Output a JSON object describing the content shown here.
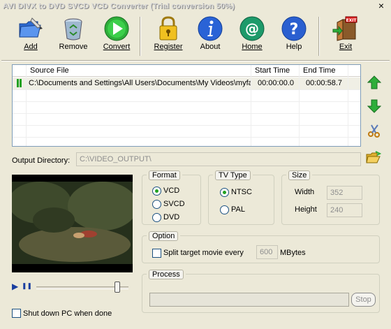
{
  "window": {
    "title": "AVI DIVX to DVD SVCD VCD Converter (Trial conversion 50%)",
    "close_glyph": "×"
  },
  "toolbar": {
    "add": "Add",
    "remove": "Remove",
    "convert": "Convert",
    "register": "Register",
    "about": "About",
    "home": "Home",
    "help": "Help",
    "exit": "Exit",
    "exit_sign": "EXIT"
  },
  "file_list": {
    "columns": [
      "Source File",
      "Start Time",
      "End Time"
    ],
    "rows": [
      {
        "source": "C:\\Documents and Settings\\All Users\\Documents\\My Videos\\myfavor.avi",
        "start": "00:00:00.0",
        "end": "00:00:58.7"
      }
    ]
  },
  "output": {
    "label": "Output Directory:",
    "value": "C:\\VIDEO_OUTPUT\\"
  },
  "format": {
    "title": "Format",
    "options": [
      "VCD",
      "SVCD",
      "DVD"
    ],
    "selected": "VCD"
  },
  "tv_type": {
    "title": "TV Type",
    "options": [
      "NTSC",
      "PAL"
    ],
    "selected": "NTSC"
  },
  "size": {
    "title": "Size",
    "width_label": "Width",
    "width_value": "352",
    "height_label": "Height",
    "height_value": "240"
  },
  "option": {
    "title": "Option",
    "split_label": "Split target movie every",
    "split_value": "600",
    "split_unit": "MBytes",
    "split_checked": false
  },
  "process": {
    "title": "Process",
    "stop_label": "Stop",
    "progress_fraction": 0
  },
  "player": {
    "play_glyph": "▶",
    "pause_glyph": "❚❚",
    "position_fraction": 0.88
  },
  "shutdown": {
    "label": "Shut down PC when done",
    "checked": false
  },
  "colors": {
    "accent_green": "#21a121",
    "window_bg": "#ece9d8"
  }
}
